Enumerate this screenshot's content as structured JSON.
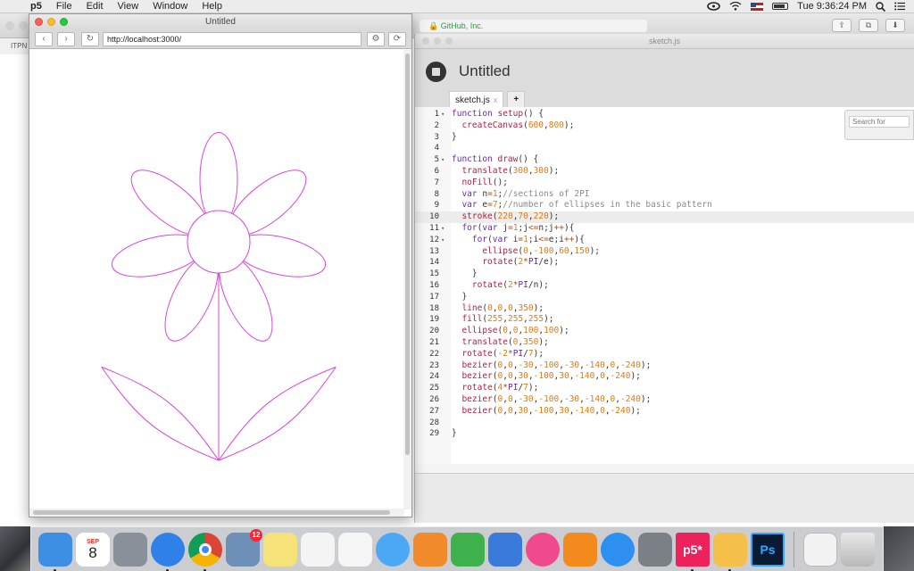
{
  "menubar": {
    "apple": "",
    "app_name": "p5",
    "items": [
      "File",
      "Edit",
      "View",
      "Window",
      "Help"
    ],
    "clock": "Tue 9:36:24 PM"
  },
  "bg_browser": {
    "address": "GitHub, Inc.",
    "tab_label": "ITPN"
  },
  "editor": {
    "window_title": "sketch.js",
    "project_title": "Untitled",
    "tabs": [
      {
        "label": "sketch.js",
        "close": "x"
      },
      {
        "label": "+"
      }
    ],
    "search_placeholder": "Search for",
    "active_line": 10
  },
  "code_lines": [
    [
      {
        "t": "function ",
        "c": "kw"
      },
      {
        "t": "setup",
        "c": "fn"
      },
      {
        "t": "() {",
        "c": ""
      }
    ],
    [
      {
        "t": "  ",
        "c": ""
      },
      {
        "t": "createCanvas",
        "c": "fn"
      },
      {
        "t": "(",
        "c": ""
      },
      {
        "t": "600",
        "c": "nm"
      },
      {
        "t": ",",
        "c": ""
      },
      {
        "t": "800",
        "c": "nm"
      },
      {
        "t": ");",
        "c": ""
      }
    ],
    [
      {
        "t": "}",
        "c": ""
      }
    ],
    [],
    [
      {
        "t": "function ",
        "c": "kw"
      },
      {
        "t": "draw",
        "c": "fn"
      },
      {
        "t": "() {",
        "c": ""
      }
    ],
    [
      {
        "t": "  ",
        "c": ""
      },
      {
        "t": "translate",
        "c": "fn"
      },
      {
        "t": "(",
        "c": ""
      },
      {
        "t": "300",
        "c": "nm"
      },
      {
        "t": ",",
        "c": ""
      },
      {
        "t": "300",
        "c": "nm"
      },
      {
        "t": ");",
        "c": ""
      }
    ],
    [
      {
        "t": "  ",
        "c": ""
      },
      {
        "t": "noFill",
        "c": "fn"
      },
      {
        "t": "();",
        "c": ""
      }
    ],
    [
      {
        "t": "  ",
        "c": ""
      },
      {
        "t": "var ",
        "c": "kw"
      },
      {
        "t": "n",
        "c": ""
      },
      {
        "t": "=",
        "c": "op"
      },
      {
        "t": "1",
        "c": "nm"
      },
      {
        "t": ";",
        "c": ""
      },
      {
        "t": "//sections of 2PI",
        "c": "cm"
      }
    ],
    [
      {
        "t": "  ",
        "c": ""
      },
      {
        "t": "var ",
        "c": "kw"
      },
      {
        "t": "e",
        "c": ""
      },
      {
        "t": "=",
        "c": "op"
      },
      {
        "t": "7",
        "c": "nm"
      },
      {
        "t": ";",
        "c": ""
      },
      {
        "t": "//number of ellipses in the basic pattern",
        "c": "cm"
      }
    ],
    [
      {
        "t": "  ",
        "c": ""
      },
      {
        "t": "stroke",
        "c": "fn"
      },
      {
        "t": "(",
        "c": ""
      },
      {
        "t": "220",
        "c": "nm"
      },
      {
        "t": ",",
        "c": ""
      },
      {
        "t": "70",
        "c": "nm"
      },
      {
        "t": ",",
        "c": ""
      },
      {
        "t": "220",
        "c": "nm"
      },
      {
        "t": ");",
        "c": ""
      }
    ],
    [
      {
        "t": "  ",
        "c": ""
      },
      {
        "t": "for",
        "c": "kw"
      },
      {
        "t": "(",
        "c": ""
      },
      {
        "t": "var ",
        "c": "kw"
      },
      {
        "t": "j",
        "c": ""
      },
      {
        "t": "=",
        "c": "op"
      },
      {
        "t": "1",
        "c": "nm"
      },
      {
        "t": ";j",
        "c": ""
      },
      {
        "t": "<=",
        "c": "op"
      },
      {
        "t": "n;j",
        "c": ""
      },
      {
        "t": "++",
        "c": "op"
      },
      {
        "t": "){",
        "c": ""
      }
    ],
    [
      {
        "t": "    ",
        "c": ""
      },
      {
        "t": "for",
        "c": "kw"
      },
      {
        "t": "(",
        "c": ""
      },
      {
        "t": "var ",
        "c": "kw"
      },
      {
        "t": "i",
        "c": ""
      },
      {
        "t": "=",
        "c": "op"
      },
      {
        "t": "1",
        "c": "nm"
      },
      {
        "t": ";i",
        "c": ""
      },
      {
        "t": "<=",
        "c": "op"
      },
      {
        "t": "e;i",
        "c": ""
      },
      {
        "t": "++",
        "c": "op"
      },
      {
        "t": "){",
        "c": ""
      }
    ],
    [
      {
        "t": "      ",
        "c": ""
      },
      {
        "t": "ellipse",
        "c": "fn"
      },
      {
        "t": "(",
        "c": ""
      },
      {
        "t": "0",
        "c": "nm"
      },
      {
        "t": ",",
        "c": ""
      },
      {
        "t": "-100",
        "c": "nm"
      },
      {
        "t": ",",
        "c": ""
      },
      {
        "t": "60",
        "c": "nm"
      },
      {
        "t": ",",
        "c": ""
      },
      {
        "t": "150",
        "c": "nm"
      },
      {
        "t": ");",
        "c": ""
      }
    ],
    [
      {
        "t": "      ",
        "c": ""
      },
      {
        "t": "rotate",
        "c": "fn"
      },
      {
        "t": "(",
        "c": ""
      },
      {
        "t": "2",
        "c": "nm"
      },
      {
        "t": "*",
        "c": "op"
      },
      {
        "t": "PI",
        "c": "kw"
      },
      {
        "t": "/e);",
        "c": ""
      }
    ],
    [
      {
        "t": "    }",
        "c": ""
      }
    ],
    [
      {
        "t": "    ",
        "c": ""
      },
      {
        "t": "rotate",
        "c": "fn"
      },
      {
        "t": "(",
        "c": ""
      },
      {
        "t": "2",
        "c": "nm"
      },
      {
        "t": "*",
        "c": "op"
      },
      {
        "t": "PI",
        "c": "kw"
      },
      {
        "t": "/n);",
        "c": ""
      }
    ],
    [
      {
        "t": "  }",
        "c": ""
      }
    ],
    [
      {
        "t": "  ",
        "c": ""
      },
      {
        "t": "line",
        "c": "fn"
      },
      {
        "t": "(",
        "c": ""
      },
      {
        "t": "0",
        "c": "nm"
      },
      {
        "t": ",",
        "c": ""
      },
      {
        "t": "0",
        "c": "nm"
      },
      {
        "t": ",",
        "c": ""
      },
      {
        "t": "0",
        "c": "nm"
      },
      {
        "t": ",",
        "c": ""
      },
      {
        "t": "350",
        "c": "nm"
      },
      {
        "t": ");",
        "c": ""
      }
    ],
    [
      {
        "t": "  ",
        "c": ""
      },
      {
        "t": "fill",
        "c": "fn"
      },
      {
        "t": "(",
        "c": ""
      },
      {
        "t": "255",
        "c": "nm"
      },
      {
        "t": ",",
        "c": ""
      },
      {
        "t": "255",
        "c": "nm"
      },
      {
        "t": ",",
        "c": ""
      },
      {
        "t": "255",
        "c": "nm"
      },
      {
        "t": ");",
        "c": ""
      }
    ],
    [
      {
        "t": "  ",
        "c": ""
      },
      {
        "t": "ellipse",
        "c": "fn"
      },
      {
        "t": "(",
        "c": ""
      },
      {
        "t": "0",
        "c": "nm"
      },
      {
        "t": ",",
        "c": ""
      },
      {
        "t": "0",
        "c": "nm"
      },
      {
        "t": ",",
        "c": ""
      },
      {
        "t": "100",
        "c": "nm"
      },
      {
        "t": ",",
        "c": ""
      },
      {
        "t": "100",
        "c": "nm"
      },
      {
        "t": ");",
        "c": ""
      }
    ],
    [
      {
        "t": "  ",
        "c": ""
      },
      {
        "t": "translate",
        "c": "fn"
      },
      {
        "t": "(",
        "c": ""
      },
      {
        "t": "0",
        "c": "nm"
      },
      {
        "t": ",",
        "c": ""
      },
      {
        "t": "350",
        "c": "nm"
      },
      {
        "t": ");",
        "c": ""
      }
    ],
    [
      {
        "t": "  ",
        "c": ""
      },
      {
        "t": "rotate",
        "c": "fn"
      },
      {
        "t": "(",
        "c": ""
      },
      {
        "t": "-2",
        "c": "nm"
      },
      {
        "t": "*",
        "c": "op"
      },
      {
        "t": "PI",
        "c": "kw"
      },
      {
        "t": "/",
        "c": ""
      },
      {
        "t": "7",
        "c": "nm"
      },
      {
        "t": ");",
        "c": ""
      }
    ],
    [
      {
        "t": "  ",
        "c": ""
      },
      {
        "t": "bezier",
        "c": "fn"
      },
      {
        "t": "(",
        "c": ""
      },
      {
        "t": "0",
        "c": "nm"
      },
      {
        "t": ",",
        "c": ""
      },
      {
        "t": "0",
        "c": "nm"
      },
      {
        "t": ",",
        "c": ""
      },
      {
        "t": "-30",
        "c": "nm"
      },
      {
        "t": ",",
        "c": ""
      },
      {
        "t": "-100",
        "c": "nm"
      },
      {
        "t": ",",
        "c": ""
      },
      {
        "t": "-30",
        "c": "nm"
      },
      {
        "t": ",",
        "c": ""
      },
      {
        "t": "-140",
        "c": "nm"
      },
      {
        "t": ",",
        "c": ""
      },
      {
        "t": "0",
        "c": "nm"
      },
      {
        "t": ",",
        "c": ""
      },
      {
        "t": "-240",
        "c": "nm"
      },
      {
        "t": ");",
        "c": ""
      }
    ],
    [
      {
        "t": "  ",
        "c": ""
      },
      {
        "t": "bezier",
        "c": "fn"
      },
      {
        "t": "(",
        "c": ""
      },
      {
        "t": "0",
        "c": "nm"
      },
      {
        "t": ",",
        "c": ""
      },
      {
        "t": "0",
        "c": "nm"
      },
      {
        "t": ",",
        "c": ""
      },
      {
        "t": "30",
        "c": "nm"
      },
      {
        "t": ",",
        "c": ""
      },
      {
        "t": "-100",
        "c": "nm"
      },
      {
        "t": ",",
        "c": ""
      },
      {
        "t": "30",
        "c": "nm"
      },
      {
        "t": ",",
        "c": ""
      },
      {
        "t": "-140",
        "c": "nm"
      },
      {
        "t": ",",
        "c": ""
      },
      {
        "t": "0",
        "c": "nm"
      },
      {
        "t": ",",
        "c": ""
      },
      {
        "t": "-240",
        "c": "nm"
      },
      {
        "t": ");",
        "c": ""
      }
    ],
    [
      {
        "t": "  ",
        "c": ""
      },
      {
        "t": "rotate",
        "c": "fn"
      },
      {
        "t": "(",
        "c": ""
      },
      {
        "t": "4",
        "c": "nm"
      },
      {
        "t": "*",
        "c": "op"
      },
      {
        "t": "PI",
        "c": "kw"
      },
      {
        "t": "/",
        "c": ""
      },
      {
        "t": "7",
        "c": "nm"
      },
      {
        "t": ");",
        "c": ""
      }
    ],
    [
      {
        "t": "  ",
        "c": ""
      },
      {
        "t": "bezier",
        "c": "fn"
      },
      {
        "t": "(",
        "c": ""
      },
      {
        "t": "0",
        "c": "nm"
      },
      {
        "t": ",",
        "c": ""
      },
      {
        "t": "0",
        "c": "nm"
      },
      {
        "t": ",",
        "c": ""
      },
      {
        "t": "-30",
        "c": "nm"
      },
      {
        "t": ",",
        "c": ""
      },
      {
        "t": "-100",
        "c": "nm"
      },
      {
        "t": ",",
        "c": ""
      },
      {
        "t": "-30",
        "c": "nm"
      },
      {
        "t": ",",
        "c": ""
      },
      {
        "t": "-140",
        "c": "nm"
      },
      {
        "t": ",",
        "c": ""
      },
      {
        "t": "0",
        "c": "nm"
      },
      {
        "t": ",",
        "c": ""
      },
      {
        "t": "-240",
        "c": "nm"
      },
      {
        "t": ");",
        "c": ""
      }
    ],
    [
      {
        "t": "  ",
        "c": ""
      },
      {
        "t": "bezier",
        "c": "fn"
      },
      {
        "t": "(",
        "c": ""
      },
      {
        "t": "0",
        "c": "nm"
      },
      {
        "t": ",",
        "c": ""
      },
      {
        "t": "0",
        "c": "nm"
      },
      {
        "t": ",",
        "c": ""
      },
      {
        "t": "30",
        "c": "nm"
      },
      {
        "t": ",",
        "c": ""
      },
      {
        "t": "-100",
        "c": "nm"
      },
      {
        "t": ",",
        "c": ""
      },
      {
        "t": "30",
        "c": "nm"
      },
      {
        "t": ",",
        "c": ""
      },
      {
        "t": "-140",
        "c": "nm"
      },
      {
        "t": ",",
        "c": ""
      },
      {
        "t": "0",
        "c": "nm"
      },
      {
        "t": ",",
        "c": ""
      },
      {
        "t": "-240",
        "c": "nm"
      },
      {
        "t": ");",
        "c": ""
      }
    ],
    [],
    [
      {
        "t": "}",
        "c": ""
      }
    ]
  ],
  "fold_lines": [
    1,
    5,
    11,
    12
  ],
  "preview": {
    "window_title": "Untitled",
    "url": "http://localhost:3000/",
    "stroke_color": "#dc46dc"
  },
  "dock": {
    "calendar_month": "SEP",
    "calendar_day": "8",
    "mail_badge": "12",
    "p5_label": "p5*",
    "ps_label": "Ps",
    "items": [
      {
        "name": "finder-icon",
        "color": "#3d8fe6",
        "running": true
      },
      {
        "name": "calendar-icon",
        "color": "#ffffff",
        "running": false
      },
      {
        "name": "launchpad-icon",
        "color": "#8a9099",
        "running": false
      },
      {
        "name": "safari-icon",
        "color": "#2f80e8",
        "running": true
      },
      {
        "name": "chrome-icon",
        "color": "#e8e8e8",
        "running": true
      },
      {
        "name": "mail-icon",
        "color": "#6e8fb8",
        "running": false
      },
      {
        "name": "notes-icon",
        "color": "#f7e27a",
        "running": false
      },
      {
        "name": "reminders-icon",
        "color": "#f4f4f4",
        "running": false
      },
      {
        "name": "photos-icon",
        "color": "#f5f5f5",
        "running": false
      },
      {
        "name": "messages-icon",
        "color": "#4aa8f5",
        "running": false
      },
      {
        "name": "pages-icon",
        "color": "#f08a2a",
        "running": false
      },
      {
        "name": "numbers-icon",
        "color": "#3fb24d",
        "running": false
      },
      {
        "name": "keynote-icon",
        "color": "#3a7ad8",
        "running": false
      },
      {
        "name": "itunes-icon",
        "color": "#f04a8c",
        "running": false
      },
      {
        "name": "ibooks-icon",
        "color": "#f28a1e",
        "running": false
      },
      {
        "name": "app-store-icon",
        "color": "#2d8ff0",
        "running": false
      },
      {
        "name": "system-preferences-icon",
        "color": "#7b7f86",
        "running": false
      },
      {
        "name": "p5-app-icon",
        "color": "#ed225d",
        "running": true
      },
      {
        "name": "sketch-icon",
        "color": "#f5c04a",
        "running": true
      },
      {
        "name": "photoshop-icon",
        "color": "#0b1a33",
        "running": false
      }
    ]
  }
}
